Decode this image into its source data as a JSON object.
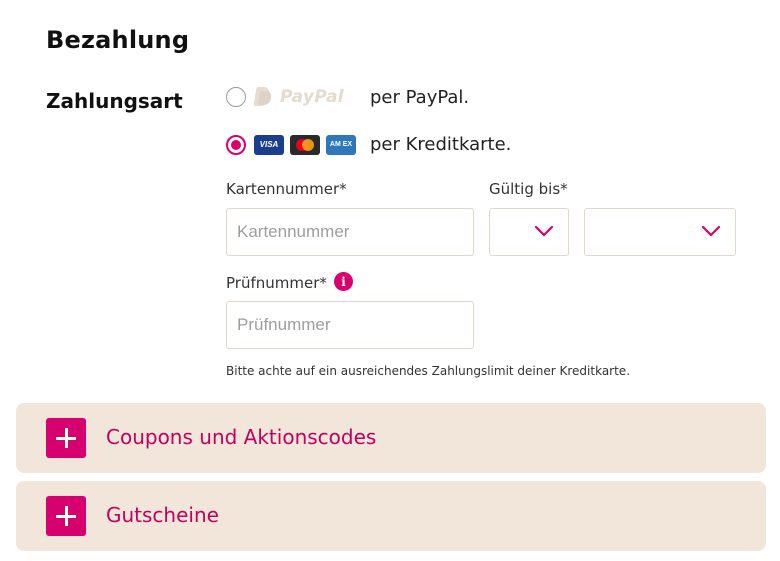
{
  "page": {
    "title": "Bezahlung"
  },
  "payment": {
    "section_label": "Zahlungsart",
    "options": [
      {
        "id": "paypal",
        "logo_text": "PayPal",
        "label": "per PayPal.",
        "selected": false
      },
      {
        "id": "creditcard",
        "label": "per Kreditkarte.",
        "selected": true,
        "card_logos": [
          "visa-logo",
          "mastercard-logo",
          "amex-logo"
        ]
      }
    ]
  },
  "card_form": {
    "card_number": {
      "label": "Kartennummer*",
      "placeholder": "Kartennummer",
      "value": ""
    },
    "valid_until": {
      "label": "Gültig bis*",
      "month_value": "",
      "year_value": ""
    },
    "cvc": {
      "label": "Prüfnummer*",
      "placeholder": "Prüfnummer",
      "value": ""
    },
    "note": "Bitte achte auf ein ausreichendes Zahlungslimit deiner Kreditkarte."
  },
  "card_logo_text": {
    "visa": "VISA",
    "amex": "AM EX"
  },
  "accordions": [
    {
      "label": "Coupons und Aktionscodes",
      "icon": "plus-icon"
    },
    {
      "label": "Gutscheine",
      "icon": "plus-icon"
    }
  ],
  "colors": {
    "accent": "#d6006e",
    "accordion_bg": "#f1e6d9",
    "input_border": "#e2d7cb"
  }
}
